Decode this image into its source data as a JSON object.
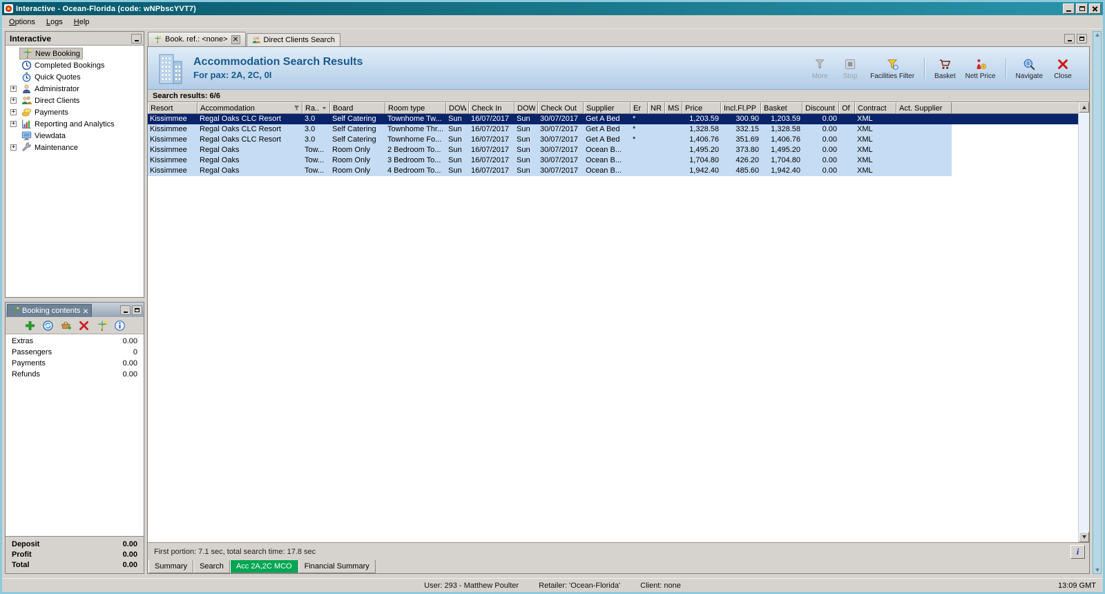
{
  "window": {
    "title": "Interactive - Ocean-Florida (code: wNPbscYVT7)"
  },
  "menubar": {
    "items": [
      "Options",
      "Logs",
      "Help"
    ]
  },
  "sidebar": {
    "title": "Interactive",
    "items": [
      {
        "label": "New Booking",
        "icon": "new-booking-icon",
        "expandable": false,
        "selected": true
      },
      {
        "label": "Completed Bookings",
        "icon": "completed-bookings-icon",
        "expandable": false,
        "selected": false
      },
      {
        "label": "Quick Quotes",
        "icon": "quick-quotes-icon",
        "expandable": false,
        "selected": false
      },
      {
        "label": "Administrator",
        "icon": "administrator-icon",
        "expandable": true,
        "selected": false
      },
      {
        "label": "Direct Clients",
        "icon": "direct-clients-icon",
        "expandable": true,
        "selected": false
      },
      {
        "label": "Payments",
        "icon": "payments-icon",
        "expandable": true,
        "selected": false
      },
      {
        "label": "Reporting and Analytics",
        "icon": "reporting-icon",
        "expandable": true,
        "selected": false
      },
      {
        "label": "Viewdata",
        "icon": "viewdata-icon",
        "expandable": false,
        "selected": false
      },
      {
        "label": "Maintenance",
        "icon": "maintenance-icon",
        "expandable": true,
        "selected": false
      }
    ]
  },
  "booking_contents": {
    "title": "Booking contents",
    "toolbar_icons": [
      "add-icon",
      "refresh-icon",
      "basket-add-icon",
      "delete-icon",
      "transfer-icon",
      "info-icon"
    ],
    "rows": [
      {
        "label": "Extras",
        "value": "0.00"
      },
      {
        "label": "Passengers",
        "value": "0"
      },
      {
        "label": "Payments",
        "value": "0.00"
      },
      {
        "label": "Refunds",
        "value": "0.00"
      }
    ],
    "totals": [
      {
        "label": "Deposit",
        "value": "0.00"
      },
      {
        "label": "Profit",
        "value": "0.00"
      },
      {
        "label": "Total",
        "value": "0.00"
      }
    ]
  },
  "main": {
    "tabs": [
      {
        "label": "Book. ref.: <none>",
        "active": true,
        "closable": true
      },
      {
        "label": "Direct Clients Search",
        "active": false,
        "closable": false
      }
    ],
    "header": {
      "title": "Accommodation Search Results",
      "subtitle": "For pax: 2A, 2C, 0I"
    },
    "toolbar": [
      {
        "label": "More",
        "icon": "more-icon",
        "disabled": true,
        "group_start": false
      },
      {
        "label": "Stop",
        "icon": "stop-icon",
        "disabled": true,
        "group_start": false
      },
      {
        "label": "Facilities Filter",
        "icon": "facilities-filter-icon",
        "disabled": false,
        "group_start": false
      },
      {
        "label": "Basket",
        "icon": "basket-icon",
        "disabled": false,
        "group_start": true
      },
      {
        "label": "Nett Price",
        "icon": "nett-price-icon",
        "disabled": false,
        "group_start": false
      },
      {
        "label": "Navigate",
        "icon": "navigate-icon",
        "disabled": false,
        "group_start": true
      },
      {
        "label": "Close",
        "icon": "close-icon",
        "disabled": false,
        "group_start": false
      }
    ],
    "results_label": "Search results: 6/6",
    "grid": {
      "columns": [
        {
          "label": "Resort"
        },
        {
          "label": "Accommodation",
          "filter": true
        },
        {
          "label": "Ra...",
          "sort": true
        },
        {
          "label": "Board"
        },
        {
          "label": "Room type"
        },
        {
          "label": "DOW"
        },
        {
          "label": "Check In"
        },
        {
          "label": "DOW"
        },
        {
          "label": "Check Out"
        },
        {
          "label": "Supplier"
        },
        {
          "label": "Er"
        },
        {
          "label": "NR"
        },
        {
          "label": "MS"
        },
        {
          "label": "Price"
        },
        {
          "label": "Incl.Fl.PP"
        },
        {
          "label": "Basket"
        },
        {
          "label": "Discount"
        },
        {
          "label": "Of"
        },
        {
          "label": "Contract"
        },
        {
          "label": "Act. Supplier"
        }
      ],
      "rows": [
        {
          "selected": true,
          "cells": [
            "Kissimmee",
            "Regal Oaks CLC Resort",
            "3.0",
            "Self Catering",
            "Townhome Tw...",
            "Sun",
            "16/07/2017",
            "Sun",
            "30/07/2017",
            "Get A Bed",
            "*",
            "",
            "",
            "1,203.59",
            "300.90",
            "1,203.59",
            "0.00",
            "",
            "XML",
            ""
          ]
        },
        {
          "selected": false,
          "cells": [
            "Kissimmee",
            "Regal Oaks CLC Resort",
            "3.0",
            "Self Catering",
            "Townhome Thr...",
            "Sun",
            "16/07/2017",
            "Sun",
            "30/07/2017",
            "Get A Bed",
            "*",
            "",
            "",
            "1,328.58",
            "332.15",
            "1,328.58",
            "0.00",
            "",
            "XML",
            ""
          ]
        },
        {
          "selected": false,
          "cells": [
            "Kissimmee",
            "Regal Oaks CLC Resort",
            "3.0",
            "Self Catering",
            "Townhome Fo...",
            "Sun",
            "16/07/2017",
            "Sun",
            "30/07/2017",
            "Get A Bed",
            "*",
            "",
            "",
            "1,406.76",
            "351.69",
            "1,406.76",
            "0.00",
            "",
            "XML",
            ""
          ]
        },
        {
          "selected": false,
          "cells": [
            "Kissimmee",
            "Regal Oaks",
            "Tow...",
            "Room Only",
            "2 Bedroom To...",
            "Sun",
            "16/07/2017",
            "Sun",
            "30/07/2017",
            "Ocean B...",
            "",
            "",
            "",
            "1,495.20",
            "373.80",
            "1,495.20",
            "0.00",
            "",
            "XML",
            ""
          ]
        },
        {
          "selected": false,
          "cells": [
            "Kissimmee",
            "Regal Oaks",
            "Tow...",
            "Room Only",
            "3 Bedroom To...",
            "Sun",
            "16/07/2017",
            "Sun",
            "30/07/2017",
            "Ocean B...",
            "",
            "",
            "",
            "1,704.80",
            "426.20",
            "1,704.80",
            "0.00",
            "",
            "XML",
            ""
          ]
        },
        {
          "selected": false,
          "cells": [
            "Kissimmee",
            "Regal Oaks",
            "Tow...",
            "Room Only",
            "4 Bedroom To...",
            "Sun",
            "16/07/2017",
            "Sun",
            "30/07/2017",
            "Ocean B...",
            "",
            "",
            "",
            "1,942.40",
            "485.60",
            "1,942.40",
            "0.00",
            "",
            "XML",
            ""
          ]
        }
      ]
    },
    "status_text": "First portion: 7.1 sec, total search time: 17.8 sec",
    "info_button_label": "i",
    "bottom_tabs": [
      {
        "label": "Summary",
        "active": false
      },
      {
        "label": "Search",
        "active": false
      },
      {
        "label": "Acc 2A,2C MCO",
        "active": true
      },
      {
        "label": "Financial Summary",
        "active": false
      }
    ]
  },
  "statusbar": {
    "user": "User: 293 - Matthew Poulter",
    "retailer": "Retailer: 'Ocean-Florida'",
    "client": "Client: none",
    "time": "13:09 GMT"
  },
  "colors": {
    "selection": "#0a246a",
    "row_blue": "#c6dcf4",
    "accent_green": "#00a651",
    "titlebar_teal": "#0a5a6c"
  }
}
